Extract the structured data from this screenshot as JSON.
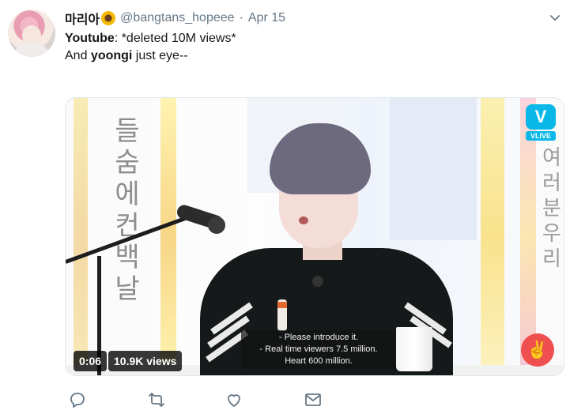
{
  "tweet": {
    "author_name": "마리아",
    "author_handle": "@bangtans_hopeee",
    "separator": "·",
    "date": "Apr 15",
    "text_line1_bold": "Youtube",
    "text_line1_rest": ": *deleted 10M views*",
    "text_line2_start": "And ",
    "text_line2_bold": "yoongi",
    "text_line2_rest": " just eye--"
  },
  "video": {
    "timestamp": "0:06",
    "views": "10.9K views",
    "logo_letter": "V",
    "logo_text": "VLIVE",
    "subtitle_lines": [
      "- Please introduce it.",
      "- Real time viewers 7.5 million.",
      "Heart 600 million."
    ],
    "korean_left": [
      "들",
      "숨",
      "에",
      "컨",
      "백",
      "날"
    ],
    "korean_right": [
      "여",
      "러",
      "분",
      "우",
      "리"
    ]
  },
  "actions": [
    "reply-icon",
    "retweet-icon",
    "like-icon",
    "share-icon"
  ],
  "colors": {
    "muted": "#657786",
    "text": "#14171a",
    "vlive": "#0ab8e8",
    "heart": "#ef4f4f"
  }
}
